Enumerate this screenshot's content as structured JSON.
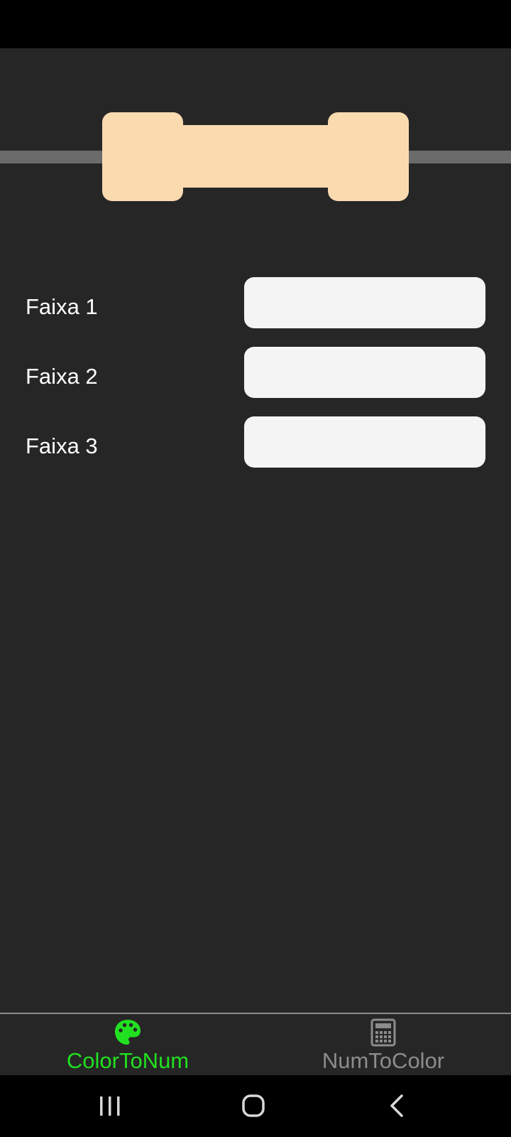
{
  "colors": {
    "background": "#262626",
    "resistor_body": "#fadaaf",
    "lead": "#6b6b6b",
    "input_fill": "#f4f4f4",
    "active_tab": "#21e020",
    "inactive_tab": "#8c8c8c"
  },
  "form": {
    "bands": [
      {
        "label": "Faixa 1",
        "value": "",
        "placeholder": ""
      },
      {
        "label": "Faixa 2",
        "value": "",
        "placeholder": ""
      },
      {
        "label": "Faixa 3",
        "value": "",
        "placeholder": ""
      }
    ]
  },
  "bottom_nav": {
    "tabs": [
      {
        "label": "ColorToNum",
        "icon": "palette-icon",
        "active": true
      },
      {
        "label": "NumToColor",
        "icon": "calculator-icon",
        "active": false
      }
    ]
  },
  "system_nav": {
    "buttons": [
      "recent-apps-icon",
      "home-icon",
      "back-icon"
    ]
  }
}
